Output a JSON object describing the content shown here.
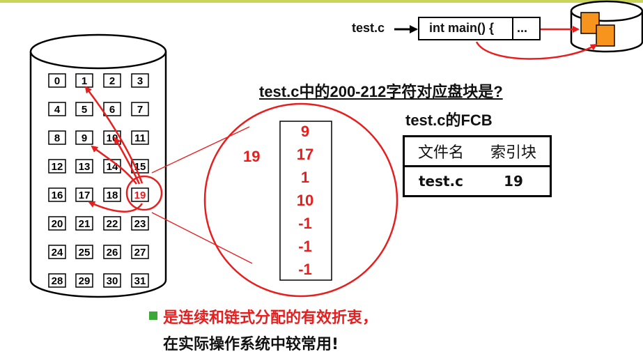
{
  "disk": {
    "blocks": [
      [
        "0",
        "1",
        "2",
        "3"
      ],
      [
        "4",
        "5",
        "6",
        "7"
      ],
      [
        "8",
        "9",
        "10",
        "11"
      ],
      [
        "12",
        "13",
        "14",
        "15"
      ],
      [
        "16",
        "17",
        "18",
        "19"
      ],
      [
        "20",
        "21",
        "22",
        "23"
      ],
      [
        "24",
        "25",
        "26",
        "27"
      ],
      [
        "28",
        "29",
        "30",
        "31"
      ]
    ],
    "highlighted_block": "19"
  },
  "file_label": "test.c",
  "code": {
    "text": "int main() {",
    "more": "..."
  },
  "index_block": {
    "label": "19",
    "entries": [
      "9",
      "17",
      "1",
      "10",
      "-1",
      "-1",
      "-1"
    ]
  },
  "question": "test.c中的200-212字符对应盘块是?",
  "fcb": {
    "title": "test.c的FCB",
    "headers": [
      "文件名",
      "索引块"
    ],
    "row": [
      "test.c",
      "19"
    ]
  },
  "bullet": {
    "line1": "是连续和链式分配的有效折衷，",
    "line2": "在实际操作系统中较常用!"
  },
  "colors": {
    "accent_red": "#e81e1e",
    "bullet_green": "#3aa935",
    "doc_orange": "#f7941d"
  }
}
